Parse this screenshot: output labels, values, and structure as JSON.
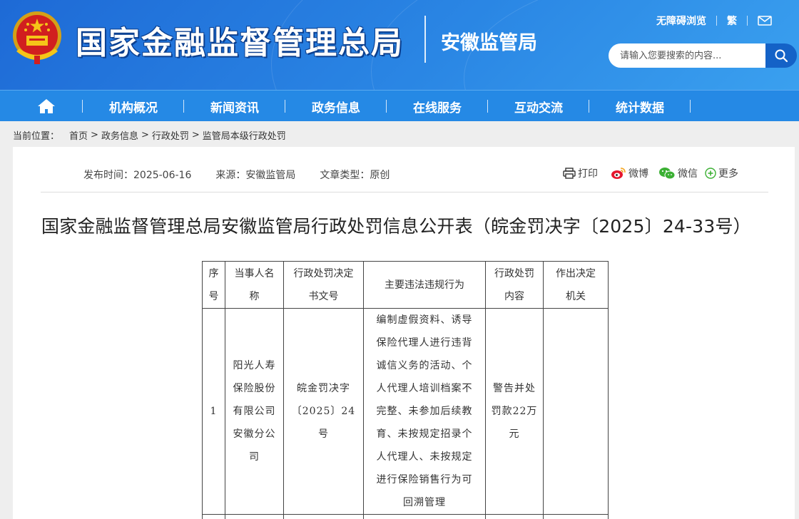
{
  "header": {
    "site_title": "国家金融监督管理总局",
    "bureau": "安徽监管局",
    "accessibility_label": "无障碍浏览",
    "traditional_label": "繁",
    "search_placeholder": "请输入您要搜索的内容..."
  },
  "nav": {
    "items": [
      {
        "label": "机构概况"
      },
      {
        "label": "新闻资讯"
      },
      {
        "label": "政务信息"
      },
      {
        "label": "在线服务"
      },
      {
        "label": "互动交流"
      },
      {
        "label": "统计数据"
      }
    ]
  },
  "breadcrumb": {
    "label": "当前位置：",
    "items": [
      "首页",
      "政务信息",
      "行政处罚",
      "监管局本级行政处罚"
    ],
    "separator": ">"
  },
  "article": {
    "publish_time": "发布时间：2025-06-16",
    "source": "来源：安徽监管局",
    "type": "文章类型：原创",
    "share": {
      "print": "打印",
      "weibo": "微博",
      "wechat": "微信",
      "more": "更多"
    },
    "title": "国家金融监督管理总局安徽监管局行政处罚信息公开表（皖金罚决字〔2025〕24-33号）"
  },
  "table": {
    "headers": [
      "序号",
      "当事人名称",
      "行政处罚决定书文号",
      "主要违法违规行为",
      "行政处罚内容",
      "作出决定机关"
    ],
    "header_lines": [
      [
        "序",
        "号"
      ],
      [
        "当事人名",
        "称"
      ],
      [
        "行政处罚决定",
        "书文号"
      ],
      [
        "主要违法违规行为"
      ],
      [
        "行政处罚",
        "内容"
      ],
      [
        "作出决定",
        "机关"
      ]
    ],
    "rows": [
      {
        "index": "1",
        "party": "阳光人寿保险股份有限公司安徽分公司",
        "party_lines": [
          "阳光人寿",
          "保险股份",
          "有限公司",
          "安徽分公",
          "司"
        ],
        "doc_no": "皖金罚决字〔2025〕24号",
        "doc_lines": [
          "皖金罚决字",
          "〔2025〕24号"
        ],
        "violation": "编制虚假资料、诱导保险代理人进行违背诚信义务的活动、个人代理人培训档案不完整、未参加后续教育、未按规定招录个人代理人、未按规定进行保险销售行为可回溯管理",
        "violation_lines": [
          "编制虚假资料、诱导",
          "保险代理人进行违背",
          "诚信义务的活动、个",
          "人代理人培训档案不",
          "完整、未参加后续教",
          "育、未按规定招录个",
          "人代理人、未按规定",
          "进行保险销售行为可",
          "回溯管理"
        ],
        "penalty": "警告并处罚款22万元",
        "penalty_lines": [
          "警告并处",
          "罚款22万",
          "元"
        ],
        "authority": ""
      }
    ]
  },
  "colors": {
    "header_blue": "#1e6ad6",
    "nav_blue": "#2589e5",
    "search_button": "#1462c7",
    "page_bg": "#eeeeee"
  }
}
